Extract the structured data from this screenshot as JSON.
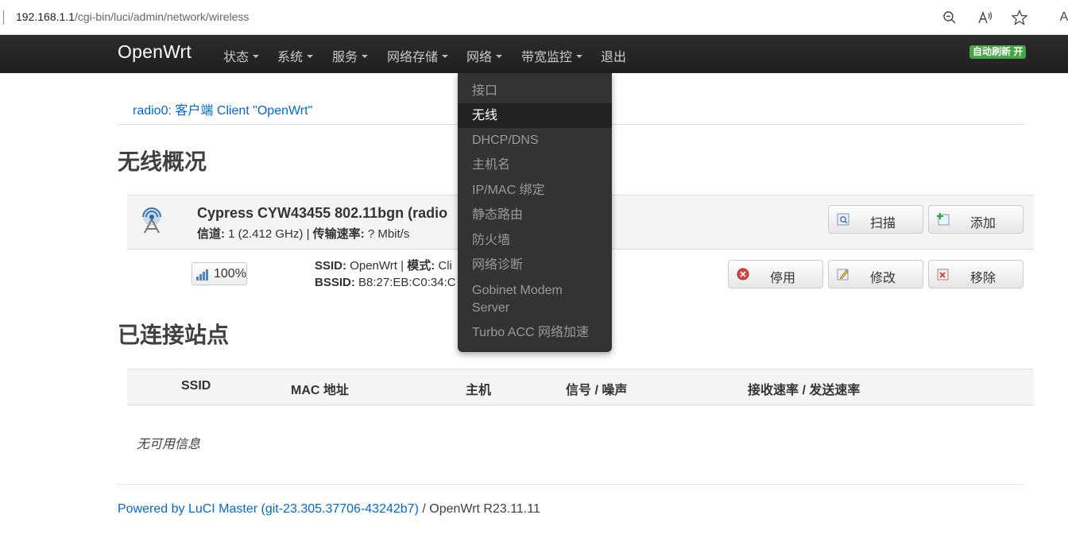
{
  "browser": {
    "url_host": "192.168.1.1",
    "url_path": "/cgi-bin/luci/admin/network/wireless",
    "icons": [
      "zoom-out-icon",
      "read-aloud-icon",
      "favorite-star-icon",
      "admin-icon"
    ],
    "admin_label": "A"
  },
  "navbar": {
    "brand": "OpenWrt",
    "menu": [
      "状态",
      "系统",
      "服务",
      "网络存储",
      "网络",
      "带宽监控",
      "退出"
    ],
    "refresh_badge": "自动刷新 开"
  },
  "dropdown": {
    "items": [
      "接口",
      "无线",
      "DHCP/DNS",
      "主机名",
      "IP/MAC 绑定",
      "静态路由",
      "防火墙",
      "网络诊断",
      "Gobinet Modem",
      "Server",
      "Turbo ACC 网络加速"
    ],
    "active": "无线"
  },
  "tab": {
    "label": "radio0: 客户端 Client \"OpenWrt\""
  },
  "overview": {
    "title": "无线概况",
    "device": {
      "name": "Cypress CYW43455 802.11bgn (radio",
      "channel_label": "信道:",
      "channel_value": "1 (2.412 GHz)",
      "rate_label": "传输速率:",
      "rate_value": "? Mbit/s",
      "sep": "|"
    },
    "buttons": {
      "scan": "扫描",
      "add": "添加",
      "disable": "停用",
      "edit": "修改",
      "remove": "移除"
    },
    "network": {
      "signal": "100%",
      "ssid_label": "SSID:",
      "ssid_value": "OpenWrt",
      "mode_label": "模式:",
      "mode_value": "Cli",
      "bssid_label": "BSSID:",
      "bssid_value": "B8:27:EB:C0:34:C",
      "sep": "|"
    }
  },
  "stations": {
    "title": "已连接站点",
    "columns": [
      "SSID",
      "MAC 地址",
      "主机",
      "信号 / 噪声",
      "接收速率 / 发送速率"
    ],
    "empty": "无可用信息"
  },
  "footer": {
    "powered": "Powered by LuCI Master (git-23.305.37706-43242b7)",
    "version": "/ OpenWrt R23.11.11"
  },
  "colors": {
    "navbar": "#222222",
    "link": "#0069d6",
    "badge_green": "#46a546",
    "dropdown": "#333333"
  }
}
